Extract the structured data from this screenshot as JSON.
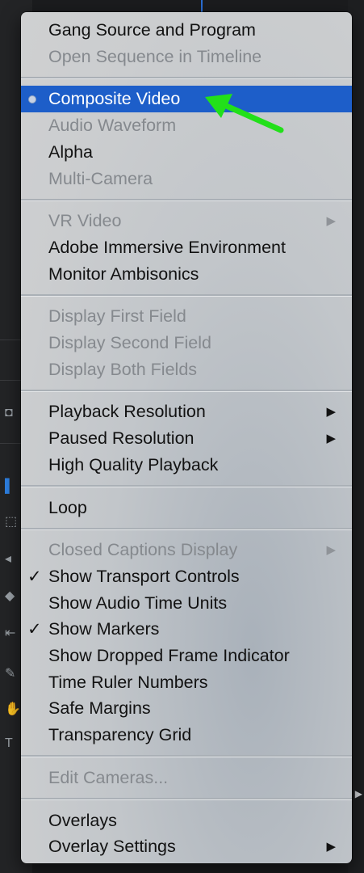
{
  "menu": {
    "sections": [
      {
        "items": [
          {
            "label": "Gang Source and Program",
            "enabled": true
          },
          {
            "label": "Open Sequence in Timeline",
            "enabled": false
          }
        ]
      },
      {
        "items": [
          {
            "label": "Composite Video",
            "enabled": true,
            "selected": true,
            "marker": "radio"
          },
          {
            "label": "Audio Waveform",
            "enabled": false
          },
          {
            "label": "Alpha",
            "enabled": true
          },
          {
            "label": "Multi-Camera",
            "enabled": false
          }
        ]
      },
      {
        "items": [
          {
            "label": "VR Video",
            "enabled": false,
            "submenu": true
          },
          {
            "label": "Adobe Immersive Environment",
            "enabled": true
          },
          {
            "label": "Monitor Ambisonics",
            "enabled": true
          }
        ]
      },
      {
        "items": [
          {
            "label": "Display First Field",
            "enabled": false
          },
          {
            "label": "Display Second Field",
            "enabled": false
          },
          {
            "label": "Display Both Fields",
            "enabled": false
          }
        ]
      },
      {
        "items": [
          {
            "label": "Playback Resolution",
            "enabled": true,
            "submenu": true
          },
          {
            "label": "Paused Resolution",
            "enabled": true,
            "submenu": true
          },
          {
            "label": "High Quality Playback",
            "enabled": true
          }
        ]
      },
      {
        "items": [
          {
            "label": "Loop",
            "enabled": true
          }
        ]
      },
      {
        "items": [
          {
            "label": "Closed Captions Display",
            "enabled": false,
            "submenu": true
          },
          {
            "label": "Show Transport Controls",
            "enabled": true,
            "checked": true
          },
          {
            "label": "Show Audio Time Units",
            "enabled": true
          },
          {
            "label": "Show Markers",
            "enabled": true,
            "checked": true
          },
          {
            "label": "Show Dropped Frame Indicator",
            "enabled": true
          },
          {
            "label": "Time Ruler Numbers",
            "enabled": true
          },
          {
            "label": "Safe Margins",
            "enabled": true
          },
          {
            "label": "Transparency Grid",
            "enabled": true
          }
        ]
      },
      {
        "items": [
          {
            "label": "Edit Cameras...",
            "enabled": false
          }
        ]
      },
      {
        "items": [
          {
            "label": "Overlays",
            "enabled": true
          },
          {
            "label": "Overlay Settings",
            "enabled": true,
            "submenu": true
          }
        ]
      }
    ]
  },
  "glyphs": {
    "check": "✓",
    "submenu_arrow": "▶"
  },
  "colors": {
    "highlight": "#1d5ec9",
    "annotation_arrow": "#22e01a",
    "disabled_text": "#85898e",
    "enabled_text": "#121212"
  },
  "annotation": {
    "icon": "green-arrow-pointer",
    "points_to": "Composite Video"
  }
}
